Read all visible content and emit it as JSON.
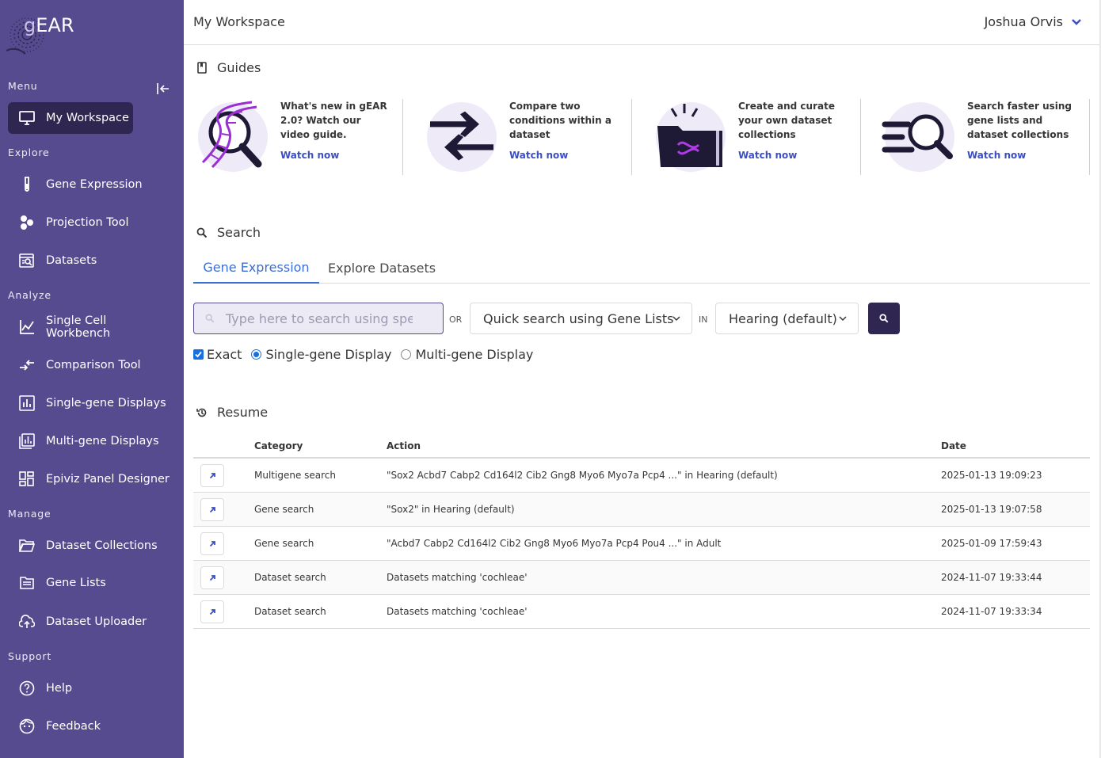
{
  "app": {
    "logo_text": "gEAR",
    "logo_prefix": "g",
    "logo_suffix": "EAR"
  },
  "sidebar": {
    "sections": {
      "menu": "Menu",
      "explore": "Explore",
      "analyze": "Analyze",
      "manage": "Manage",
      "support": "Support"
    },
    "items": {
      "my_workspace": "My Workspace",
      "gene_expression": "Gene Expression",
      "projection_tool": "Projection Tool",
      "datasets": "Datasets",
      "single_cell_workbench": "Single Cell Workbench",
      "comparison_tool": "Comparison Tool",
      "single_gene_displays": "Single-gene Displays",
      "multi_gene_displays": "Multi-gene Displays",
      "epiviz_panel_designer": "Epiviz Panel Designer",
      "dataset_collections": "Dataset Collections",
      "gene_lists": "Gene Lists",
      "dataset_uploader": "Dataset Uploader",
      "help": "Help",
      "feedback": "Feedback"
    },
    "colors": {
      "background": "#574b90",
      "active": "#2f2652"
    }
  },
  "header": {
    "page_title": "My Workspace",
    "user_name": "Joshua Orvis"
  },
  "guides": {
    "title": "Guides",
    "cards": [
      {
        "text": "What's new in gEAR 2.0? Watch our video guide.",
        "link": "Watch now"
      },
      {
        "text": "Compare two conditions within a dataset",
        "link": "Watch now"
      },
      {
        "text": "Create and curate your own dataset collections",
        "link": "Watch now"
      },
      {
        "text": "Search faster using gene lists and dataset collections",
        "link": "Watch now"
      }
    ]
  },
  "search": {
    "title": "Search",
    "tabs": [
      "Gene Expression",
      "Explore Datasets"
    ],
    "input_placeholder": "Type here to search using specific genes",
    "or_label": "OR",
    "gene_list_select": "Quick search using Gene Lists",
    "in_label": "IN",
    "collection_select": "Hearing (default)",
    "exact_label": "Exact",
    "exact_checked": true,
    "single_gene_label": "Single-gene Display",
    "multi_gene_label": "Multi-gene Display",
    "display_mode": "single"
  },
  "resume": {
    "title": "Resume",
    "columns": {
      "category": "Category",
      "action": "Action",
      "date": "Date"
    },
    "rows": [
      {
        "category": "Multigene search",
        "action": "\"Sox2 Acbd7 Cabp2 Cd164l2 Cib2 Gng8 Myo6 Myo7a Pcp4 ...\" in Hearing (default)",
        "date": "2025-01-13 19:09:23"
      },
      {
        "category": "Gene search",
        "action": "\"Sox2\" in Hearing (default)",
        "date": "2025-01-13 19:07:58"
      },
      {
        "category": "Gene search",
        "action": "\"Acbd7 Cabp2 Cd164l2 Cib2 Gng8 Myo6 Myo7a Pcp4 Pou4 ...\" in Adult",
        "date": "2025-01-09 17:59:43"
      },
      {
        "category": "Dataset search",
        "action": "Datasets matching 'cochleae'",
        "date": "2024-11-07 19:33:44"
      },
      {
        "category": "Dataset search",
        "action": "Datasets matching 'cochleae'",
        "date": "2024-11-07 19:33:34"
      }
    ]
  }
}
